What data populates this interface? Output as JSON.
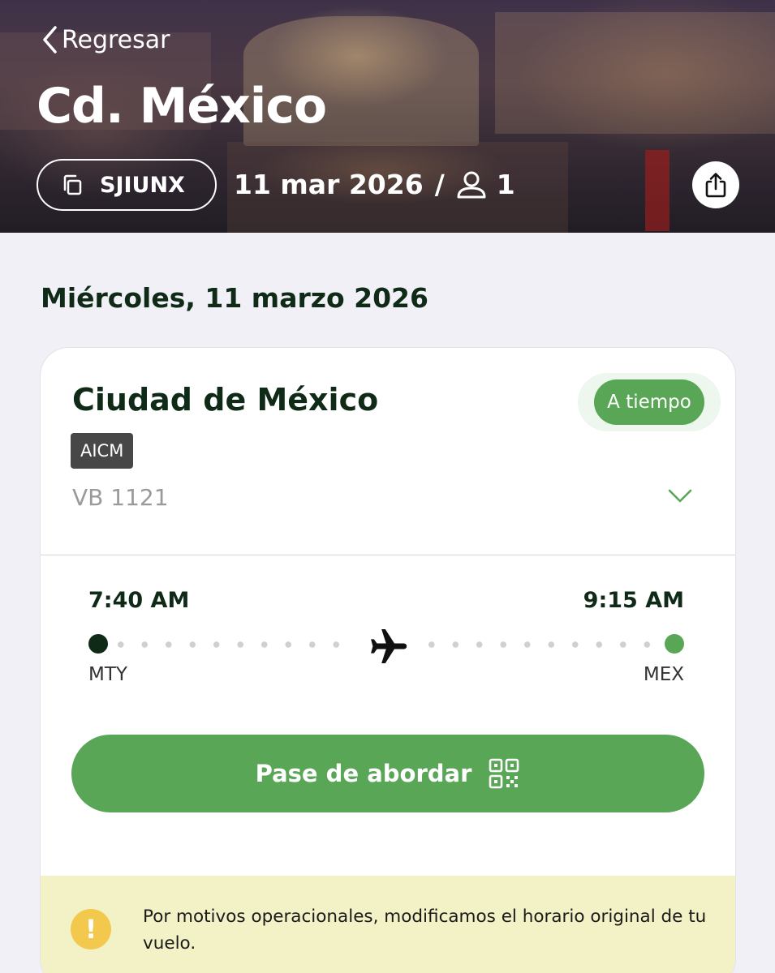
{
  "header": {
    "back_label": "Regresar",
    "city": "Cd. México",
    "reservation_code": "SJIUNX",
    "date": "11 mar 2026",
    "separator": "/",
    "passengers": "1"
  },
  "day_heading": "Miércoles, 11 marzo 2026",
  "flight": {
    "destination": "Ciudad de México",
    "status": "A tiempo",
    "airport_tag": "AICM",
    "flight_number": "VB 1121",
    "departure_time": "7:40 AM",
    "arrival_time": "9:15 AM",
    "origin_code": "MTY",
    "destination_code": "MEX",
    "boarding_pass_label": "Pase de abordar"
  },
  "notice": {
    "icon": "!",
    "text": "Por motivos operacionales, modificamos el horario original de tu vuelo."
  },
  "icons": {
    "back": "chevron-left-icon",
    "copy": "copy-icon",
    "passenger": "person-icon",
    "share": "share-icon",
    "expand": "chevron-down-icon",
    "plane": "airplane-icon",
    "qr": "qr-code-icon",
    "warning": "exclamation-icon"
  },
  "colors": {
    "primary_green": "#5aa657",
    "dark_green": "#0f2a17",
    "page_bg": "#f1f0f6",
    "notice_bg": "#f3f1c6",
    "warning_yellow": "#f2c94c",
    "tag_gray": "#474747"
  }
}
